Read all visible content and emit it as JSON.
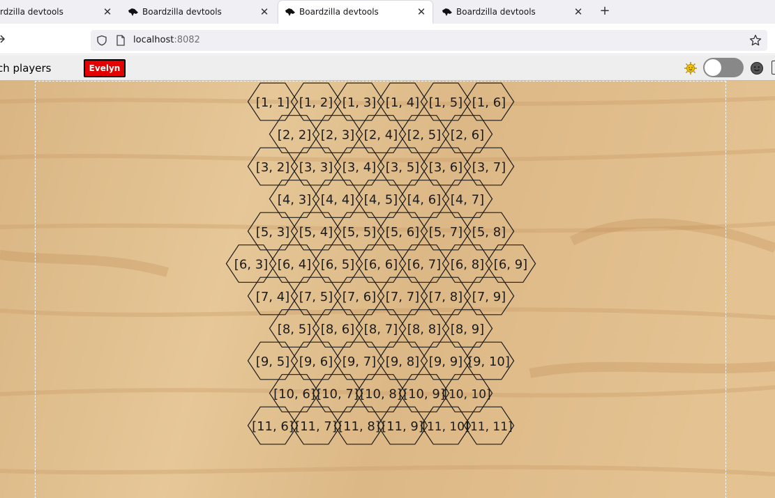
{
  "browser": {
    "tabs": [
      {
        "title": "Boardzilla devtools",
        "active": false
      },
      {
        "title": "Boardzilla devtools",
        "active": false
      },
      {
        "title": "Boardzilla devtools",
        "active": true
      },
      {
        "title": "Boardzilla devtools",
        "active": false
      }
    ],
    "tab0_title_visible": "rdzilla devtools",
    "close_glyph": "✕",
    "new_tab_glyph": "+",
    "url_host": "localhost",
    "url_port": ":8082"
  },
  "app": {
    "switch_players_label": "ch players",
    "current_player": "Evelyn",
    "player_color": "#e30000",
    "sun_icon": "sun-icon",
    "face_icon": "face-icon",
    "dark_mode_toggle": "off"
  },
  "board": {
    "rows": [
      [
        "[1, 1]",
        "[1, 2]",
        "[1, 3]",
        "[1, 4]",
        "[1, 5]",
        "[1, 6]"
      ],
      [
        "[2, 2]",
        "[2, 3]",
        "[2, 4]",
        "[2, 5]",
        "[2, 6]"
      ],
      [
        "[3, 2]",
        "[3, 3]",
        "[3, 4]",
        "[3, 5]",
        "[3, 6]",
        "[3, 7]"
      ],
      [
        "[4, 3]",
        "[4, 4]",
        "[4, 5]",
        "[4, 6]",
        "[4, 7]"
      ],
      [
        "[5, 3]",
        "[5, 4]",
        "[5, 5]",
        "[5, 6]",
        "[5, 7]",
        "[5, 8]"
      ],
      [
        "[6, 3]",
        "[6, 4]",
        "[6, 5]",
        "[6, 6]",
        "[6, 7]",
        "[6, 8]",
        "[6, 9]"
      ],
      [
        "[7, 4]",
        "[7, 5]",
        "[7, 6]",
        "[7, 7]",
        "[7, 8]",
        "[7, 9]"
      ],
      [
        "[8, 5]",
        "[8, 6]",
        "[8, 7]",
        "[8, 8]",
        "[8, 9]"
      ],
      [
        "[9, 5]",
        "[9, 6]",
        "[9, 7]",
        "[9, 8]",
        "[9, 9]",
        "[9, 10]"
      ],
      [
        "[10, 6]",
        "[10, 7]",
        "[10, 8]",
        "[10, 9]",
        "[10, 10]"
      ],
      [
        "[11, 6]",
        "[11, 7]",
        "[11, 8]",
        "[11, 9]",
        "[11, 10]",
        "[11, 11]"
      ]
    ]
  }
}
